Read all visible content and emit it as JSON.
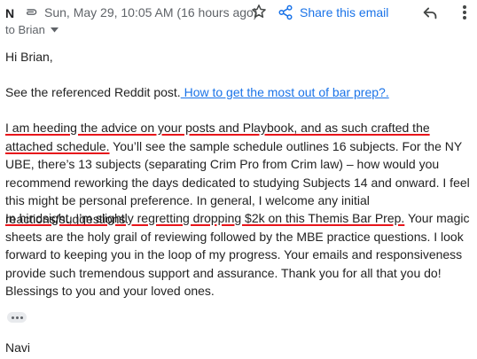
{
  "header": {
    "sender_initial": "N",
    "date": "Sun, May 29, 10:05 AM (16 hours ago)",
    "share_label": "Share this email",
    "recipient": "to Brian"
  },
  "icons": {
    "attach": "paperclip-icon",
    "star": "star-icon",
    "share": "share-icon",
    "reply": "reply-icon",
    "more": "more-vert-icon",
    "recipient_dropdown": "chevron-down-icon",
    "show_trimmed": "more-horiz-icon"
  },
  "colors": {
    "link": "#1a73e8",
    "underline_mark": "#e8151b",
    "meta": "#5f6368",
    "text": "#222222"
  },
  "message": {
    "greeting": "Hi Brian,",
    "p1_text": "See the referenced Reddit post.",
    "p1_link": " How to get the most out of bar prep?.",
    "p2_marked": "I am heeding the advice on your posts and Playbook, and as such crafted the attached schedule.",
    "p2_rest": " You’ll see the sample schedule outlines 16 subjects. For the NY UBE, there’s 13 subjects (separating Crim Pro from Crim law) – how would you recommend reworking the days dedicated to studying Subjects 14 and onward. I feel this might be personal preference. In general, I welcome any initial reactions/suggestions.",
    "p3_marked": "In hindsight, I’m slightly regretting dropping $2k on this Themis Bar Prep.",
    "p3_rest": " Your magic sheets are the holy grail of reviewing followed by the MBE practice questions. I look forward to keeping you in the loop of my progress. Your emails and responsiveness provide such tremendous support and assurance. Thank you for all that you do! Blessings to you and your loved ones.",
    "signature": "Navi"
  }
}
